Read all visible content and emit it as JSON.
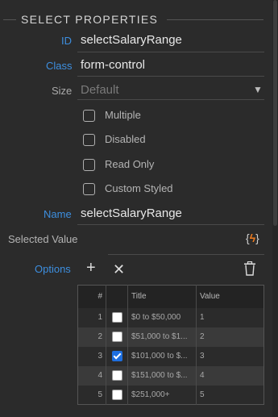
{
  "section": {
    "title": "SELECT PROPERTIES"
  },
  "fields": {
    "id": {
      "label": "ID",
      "value": "selectSalaryRange"
    },
    "class": {
      "label": "Class",
      "value": "form-control"
    },
    "size": {
      "label": "Size",
      "value": "Default"
    },
    "name": {
      "label": "Name",
      "value": "selectSalaryRange"
    }
  },
  "checkboxes": [
    {
      "label": "Multiple",
      "checked": false
    },
    {
      "label": "Disabled",
      "checked": false
    },
    {
      "label": "Read Only",
      "checked": false
    },
    {
      "label": "Custom Styled",
      "checked": false
    }
  ],
  "selected_value": {
    "label": "Selected Value",
    "value": "",
    "icon": "dynamic-data-icon"
  },
  "options": {
    "label": "Options",
    "add_icon": "+",
    "remove_icon": "✕",
    "columns": {
      "num": "#",
      "check": "",
      "title": "Title",
      "value": "Value"
    },
    "rows": [
      {
        "num": "1",
        "checked": false,
        "title": "$0 to $50,000",
        "value": "1"
      },
      {
        "num": "2",
        "checked": false,
        "title": "$51,000 to $1...",
        "value": "2"
      },
      {
        "num": "3",
        "checked": true,
        "title": "$101,000 to $...",
        "value": "3"
      },
      {
        "num": "4",
        "checked": false,
        "title": "$151,000 to $...",
        "value": "4"
      },
      {
        "num": "5",
        "checked": false,
        "title": "$251,000+",
        "value": "5"
      }
    ]
  },
  "colors": {
    "accent_label": "#3d8fe0",
    "dynamic_icon": "#f07c1e",
    "checked": "#1e6fe0"
  }
}
